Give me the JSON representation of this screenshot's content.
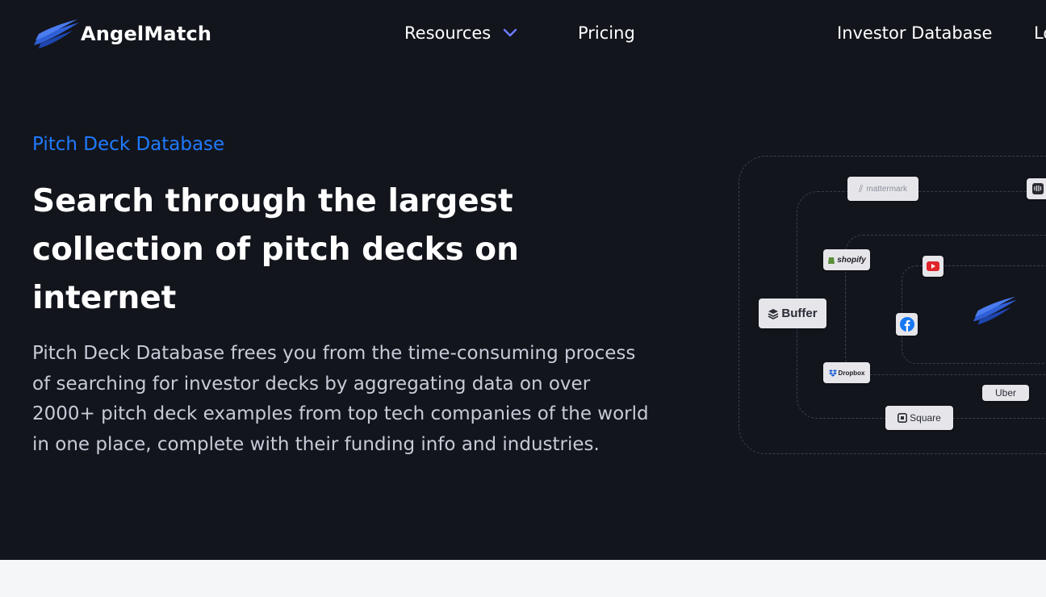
{
  "nav": {
    "brand": "AngelMatch",
    "items": [
      {
        "label": "Resources"
      },
      {
        "label": "Pricing"
      },
      {
        "label": "Investor Database"
      },
      {
        "label": "Lo"
      }
    ]
  },
  "hero": {
    "eyebrow": "Pitch Deck Database",
    "title": "Search through the largest collection of pitch decks on internet",
    "description": "Pitch Deck Database frees you from the time-consuming process of searching for investor decks by aggregating data on over 2000+ pitch deck examples from top tech companies of the world in one place, complete with their funding info and industries."
  },
  "illustration": {
    "logos": {
      "mattermark": "mattermark",
      "shopify": "shopify",
      "buffer": "Buffer",
      "dropbox": "Dropbox",
      "uber": "Uber",
      "square": "Square"
    }
  },
  "colors": {
    "background": "#13151d",
    "accent": "#1f7bff",
    "text": "#ffffff",
    "muted_text": "#c8cbd6",
    "chip": "#e6e6ea"
  },
  "icons": [
    "angelmatch-logo-icon",
    "chevron-down-icon",
    "youtube-icon",
    "facebook-icon",
    "buffer-icon",
    "dropbox-icon",
    "square-icon",
    "intercom-icon",
    "shopify-icon",
    "mattermark-icon"
  ]
}
